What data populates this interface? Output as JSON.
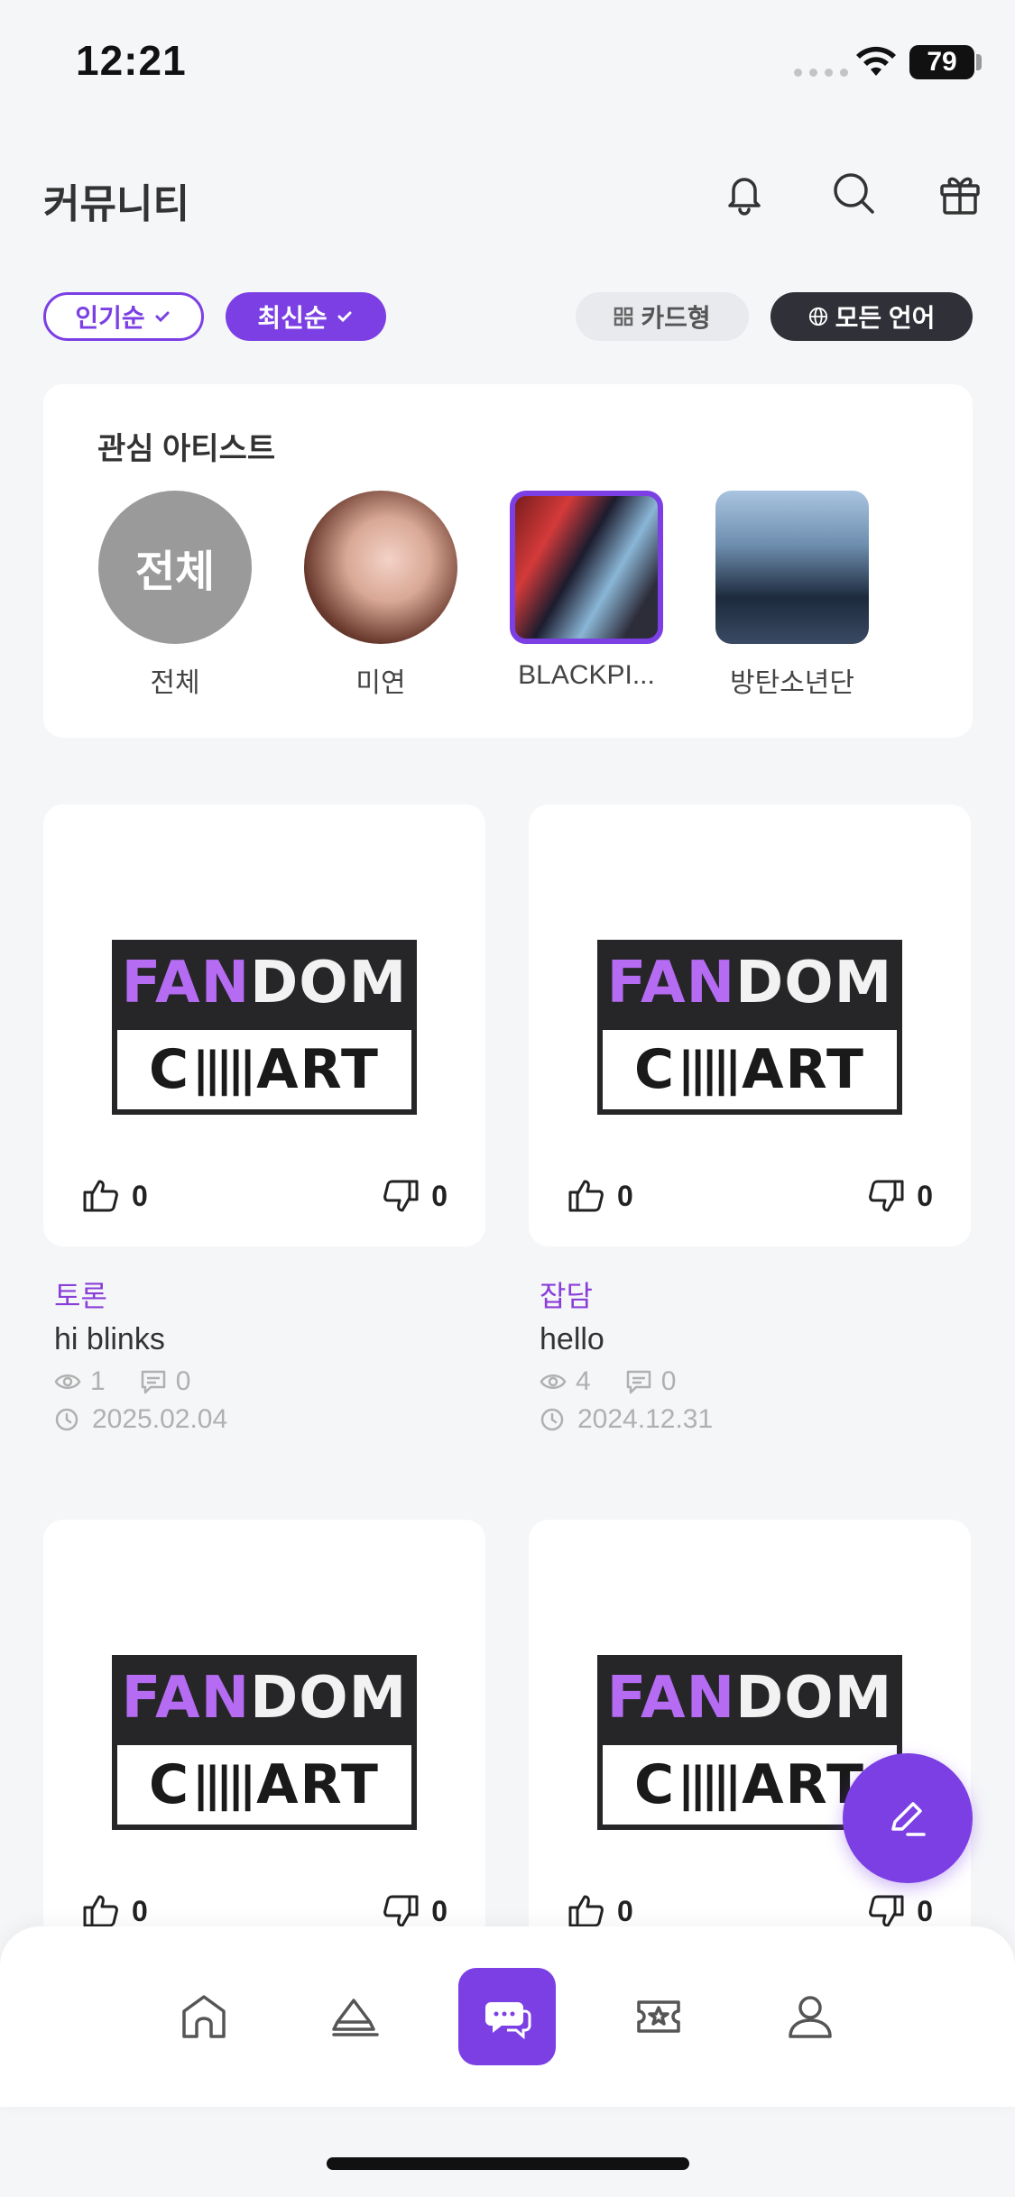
{
  "status_bar": {
    "time": "12:21",
    "battery": "79"
  },
  "header": {
    "title": "커뮤니티"
  },
  "filters": {
    "popular": "인기순",
    "latest": "최신순",
    "view_mode": "카드형",
    "language": "모든 언어"
  },
  "artists": {
    "title": "관심 아티스트",
    "items": [
      {
        "name": "전체",
        "avatar_text": "전체"
      },
      {
        "name": "미연"
      },
      {
        "name": "BLACKPI..."
      },
      {
        "name": "방탄소년단"
      }
    ]
  },
  "logo": {
    "fan": "FAN",
    "dom": "DOM",
    "chart_left": "C",
    "chart_bars": "|||||",
    "chart_right": "ART"
  },
  "posts": [
    {
      "category": "토론",
      "title": "hi blinks",
      "views": "1",
      "comments": "0",
      "date": "2025.02.04",
      "likes": "0",
      "dislikes": "0"
    },
    {
      "category": "잡담",
      "title": "hello",
      "views": "4",
      "comments": "0",
      "date": "2024.12.31",
      "likes": "0",
      "dislikes": "0"
    },
    {
      "likes": "0",
      "dislikes": "0"
    },
    {
      "likes": "0",
      "dislikes": "0"
    }
  ],
  "colors": {
    "accent": "#7b3fe4",
    "dark_pill": "#2f3038",
    "category": "#8a3ed8"
  },
  "icons": {
    "header": [
      "bell-icon",
      "search-icon",
      "gift-icon"
    ],
    "nav": [
      "home-icon",
      "eraser-icon",
      "chat-icon",
      "ticket-icon",
      "profile-icon"
    ],
    "fab": "pencil-icon"
  }
}
